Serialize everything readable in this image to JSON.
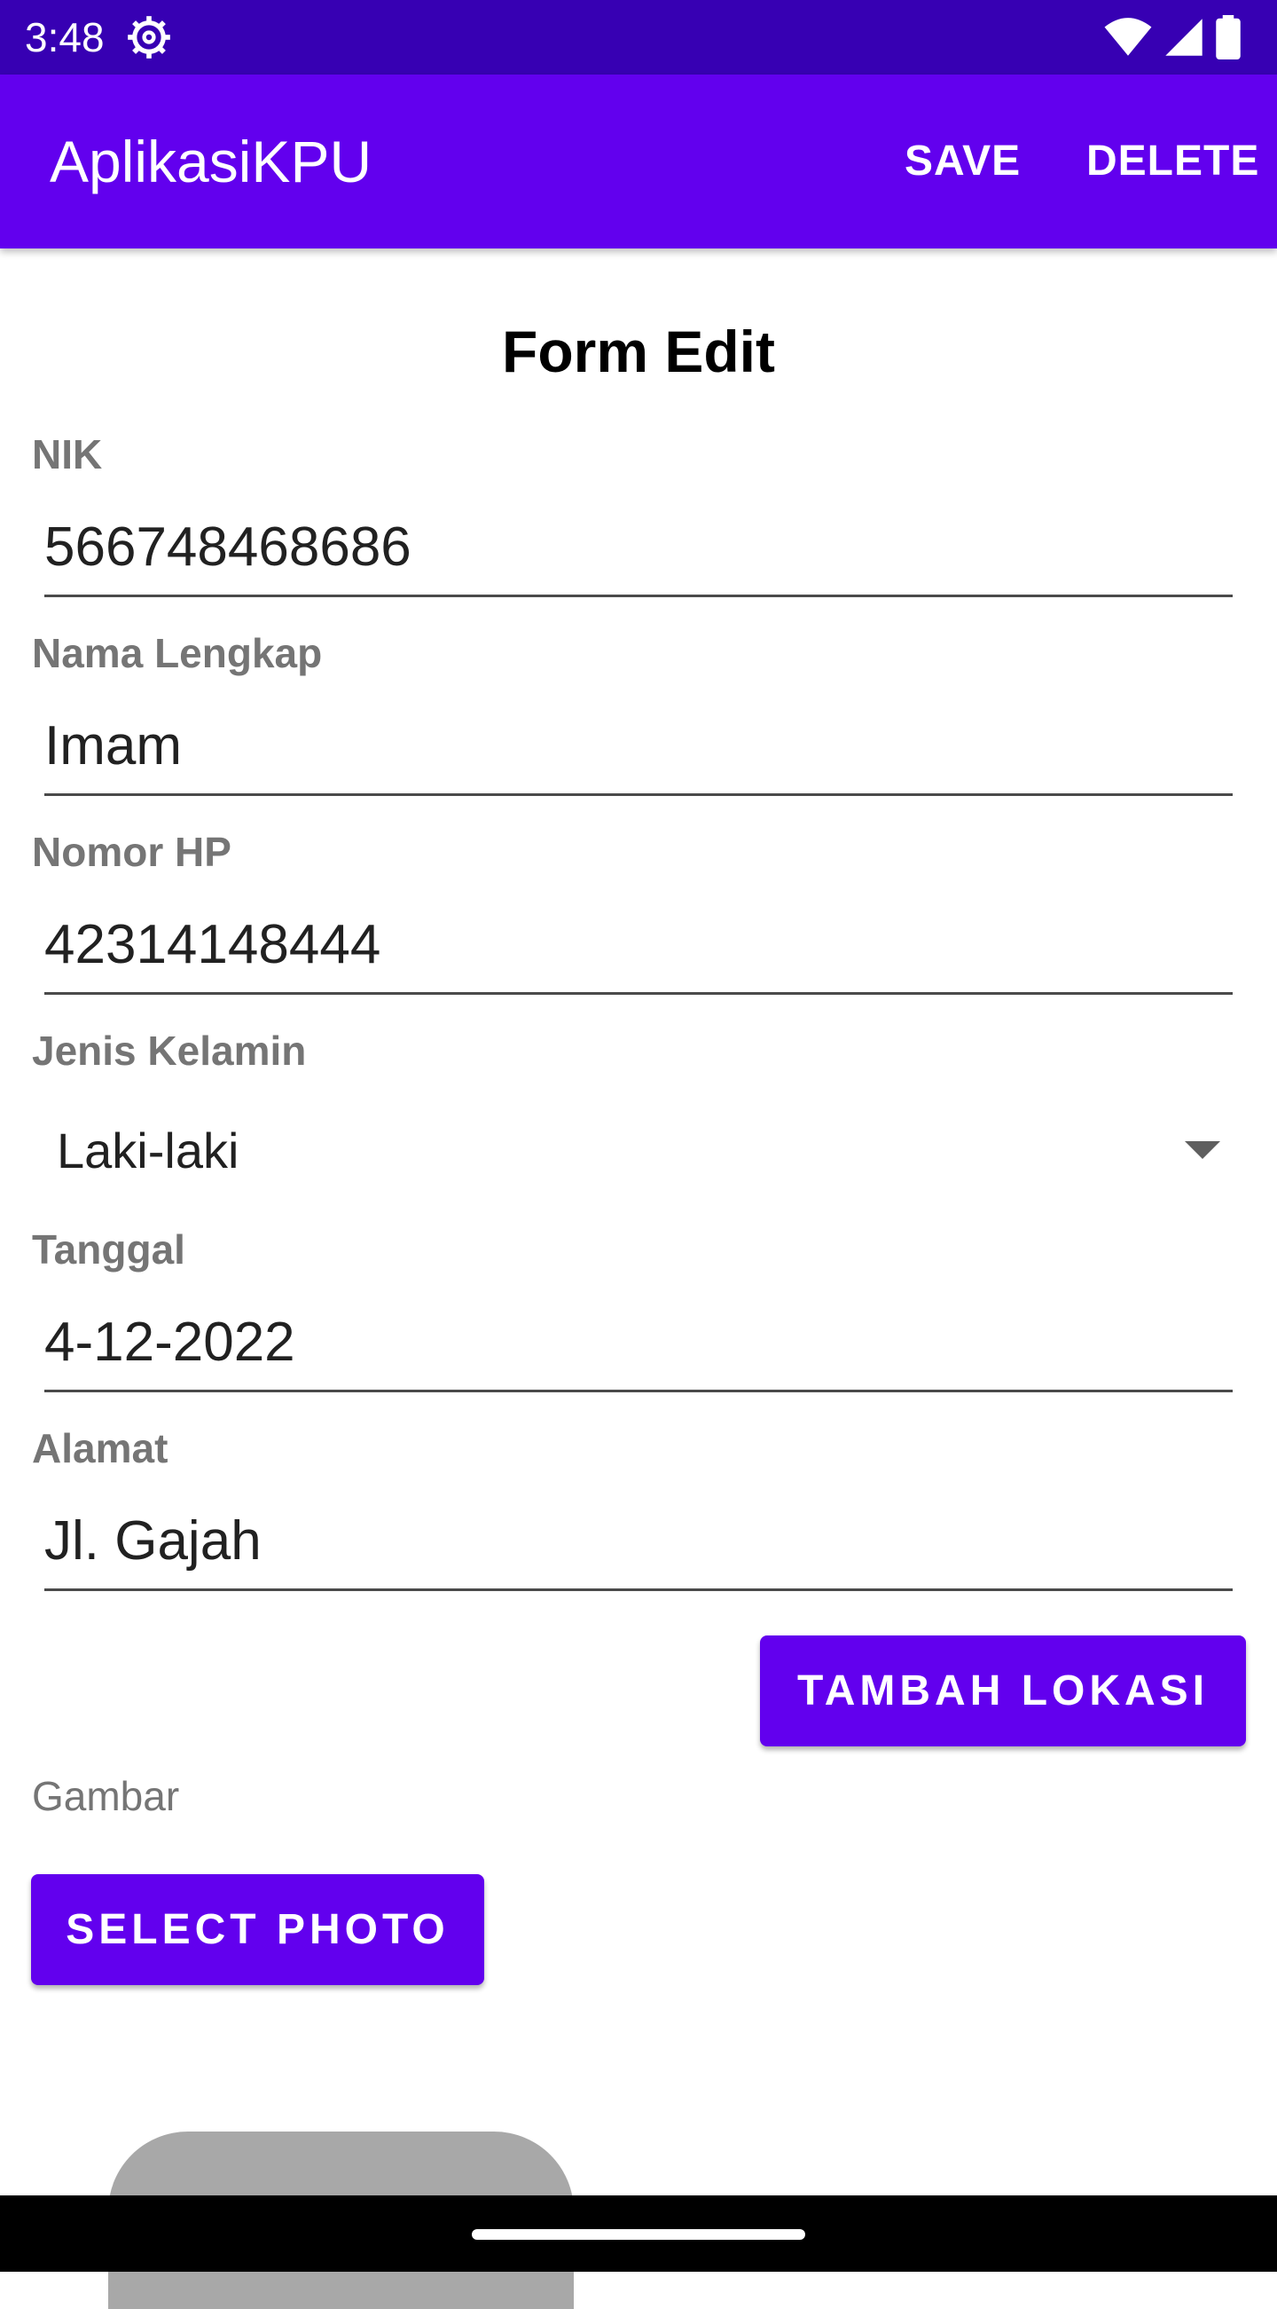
{
  "status_bar": {
    "time": "3:48",
    "icons": [
      "settings-icon",
      "wifi-icon",
      "signal-icon",
      "battery-icon"
    ]
  },
  "app_bar": {
    "title": "AplikasiKPU",
    "save_label": "SAVE",
    "delete_label": "DELETE"
  },
  "form": {
    "title": "Form Edit",
    "nik": {
      "label": "NIK",
      "value": "566748468686"
    },
    "nama": {
      "label": "Nama Lengkap",
      "value": "Imam"
    },
    "hp": {
      "label": "Nomor HP",
      "value": "42314148444"
    },
    "gender": {
      "label": "Jenis Kelamin",
      "selected": "Laki-laki"
    },
    "tanggal": {
      "label": "Tanggal",
      "value": "4-12-2022"
    },
    "alamat": {
      "label": "Alamat",
      "value": "Jl. Gajah"
    },
    "tambah_lokasi_label": "TAMBAH LOKASI",
    "gambar_label": "Gambar",
    "select_photo_label": "SELECT PHOTO"
  },
  "colors": {
    "primary": "#6200ee",
    "primary_dark": "#3700b3",
    "label_gray": "#757575"
  }
}
